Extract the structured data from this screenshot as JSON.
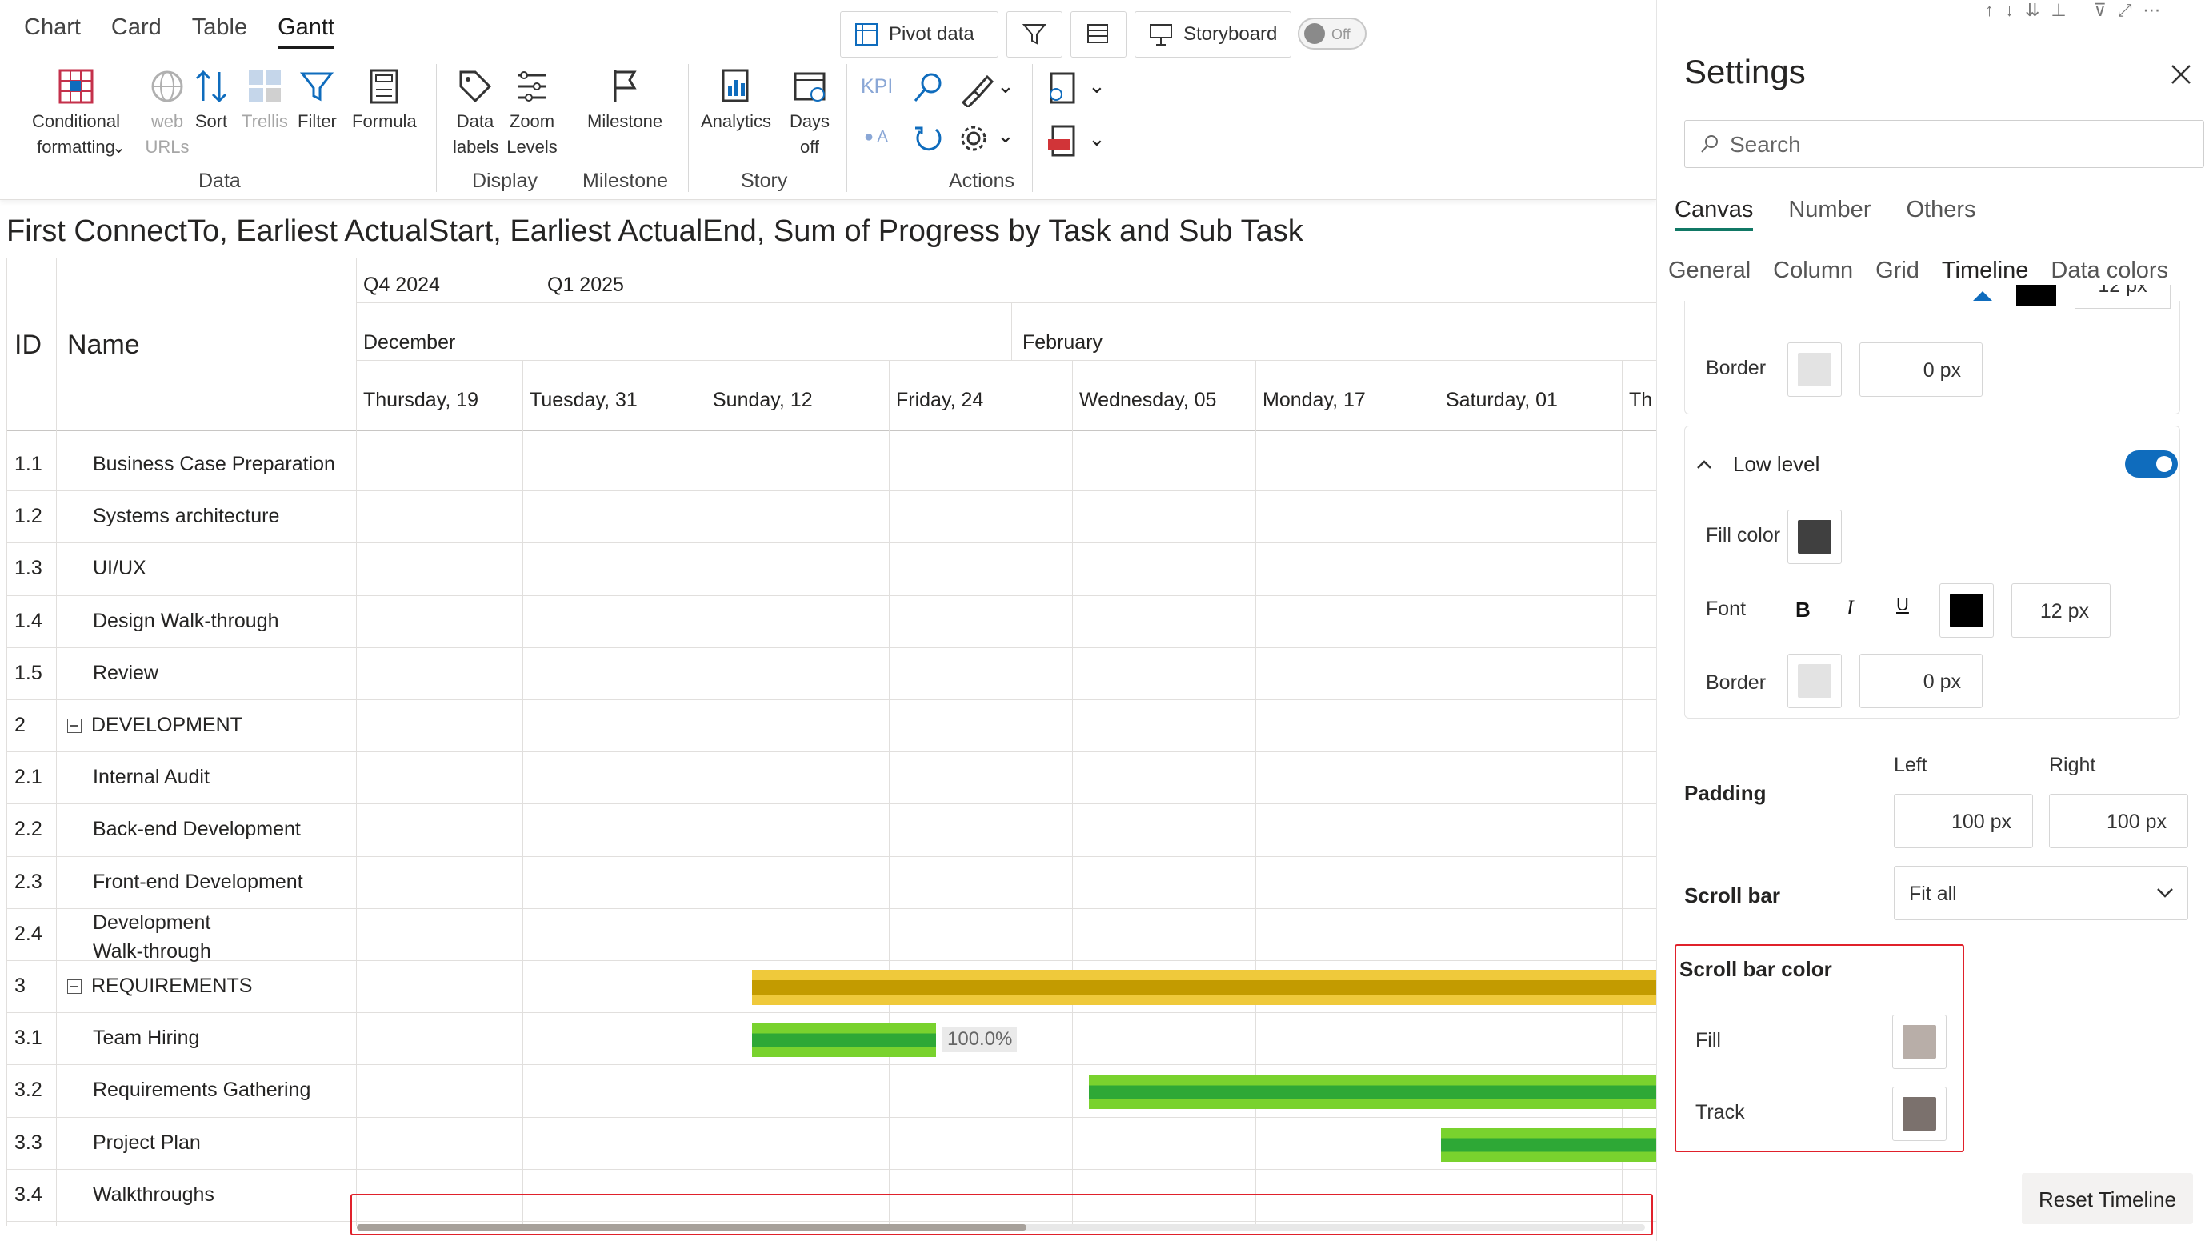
{
  "visual_tabs": [
    "Chart",
    "Card",
    "Table",
    "Gantt"
  ],
  "ribbon": {
    "data_group": {
      "label": "Data",
      "buttons": [
        "Conditional formatting",
        "web URLs",
        "Sort",
        "Trellis",
        "Filter",
        "Formula"
      ]
    },
    "display_group": {
      "label": "Display",
      "buttons": [
        "Data labels",
        "Zoom Levels"
      ]
    },
    "milestone_group": {
      "label": "Milestone",
      "buttons": [
        "Milestone"
      ]
    },
    "story_group": {
      "label": "Story",
      "buttons": [
        "Analytics",
        "Days off"
      ]
    },
    "actions_group": {
      "label": "Actions",
      "kpi": "KPI",
      "ai_label": "A"
    },
    "top_buttons": {
      "pivot": "Pivot data",
      "storyboard": "Storyboard",
      "toggle": "Off"
    }
  },
  "chart": {
    "title": "First ConnectTo, Earliest ActualStart, Earliest ActualEnd, Sum of Progress by Task and Sub Task",
    "headers": {
      "id": "ID",
      "name": "Name"
    },
    "quarters": [
      "Q4 2024",
      "Q1 2025"
    ],
    "months": [
      "December",
      "February"
    ],
    "dates": [
      "Thursday, 19",
      "Tuesday, 31",
      "Sunday, 12",
      "Friday, 24",
      "Wednesday, 05",
      "Monday, 17",
      "Saturday, 01",
      "Th"
    ],
    "rows": [
      {
        "id": "1.1",
        "name": "Business Case Preparation"
      },
      {
        "id": "1.2",
        "name": "Systems architecture"
      },
      {
        "id": "1.3",
        "name": "UI/UX"
      },
      {
        "id": "1.4",
        "name": "Design Walk-through"
      },
      {
        "id": "1.5",
        "name": "Review"
      },
      {
        "id": "2",
        "name": "DEVELOPMENT",
        "group": true
      },
      {
        "id": "2.1",
        "name": "Internal Audit"
      },
      {
        "id": "2.2",
        "name": "Back-end Development"
      },
      {
        "id": "2.3",
        "name": "Front-end Development"
      },
      {
        "id": "2.4",
        "name": "Development",
        "name2": "Walk-through"
      },
      {
        "id": "3",
        "name": "REQUIREMENTS",
        "group": true
      },
      {
        "id": "3.1",
        "name": "Team Hiring"
      },
      {
        "id": "3.2",
        "name": "Requirements Gathering"
      },
      {
        "id": "3.3",
        "name": "Project Plan"
      },
      {
        "id": "3.4",
        "name": "Walkthroughs"
      }
    ],
    "progress_label": "100.0%",
    "colors": {
      "summary": "#c39b00",
      "summary_light": "#efc93b",
      "task": "#2ea836",
      "task_light": "#79d22e"
    },
    "scrollbar_position": 0.52
  },
  "settings": {
    "title": "Settings",
    "search_placeholder": "Search",
    "tabs": [
      "Canvas",
      "Number",
      "Others"
    ],
    "subtabs": [
      "General",
      "Column",
      "Grid",
      "Timeline",
      "Data colors"
    ],
    "top_cut": {
      "value": "12 px"
    },
    "border_label": "Border",
    "border_value": "0 px",
    "low_level": {
      "title": "Low level",
      "fill_color_label": "Fill color",
      "fill_color": "#404040",
      "font_label": "Font",
      "font_bold": "B",
      "font_italic": "I",
      "font_underline": "U",
      "font_color": "#000000",
      "font_size": "12 px",
      "border_label": "Border",
      "border_value": "0 px"
    },
    "padding": {
      "label": "Padding",
      "left_label": "Left",
      "right_label": "Right",
      "left": "100 px",
      "right": "100 px"
    },
    "scroll_bar": {
      "label": "Scroll bar",
      "value": "Fit all"
    },
    "scroll_bar_color": {
      "label": "Scroll bar color",
      "fill_label": "Fill",
      "fill": "#b8aea8",
      "track_label": "Track",
      "track": "#7b716d"
    },
    "reset": "Reset Timeline"
  }
}
